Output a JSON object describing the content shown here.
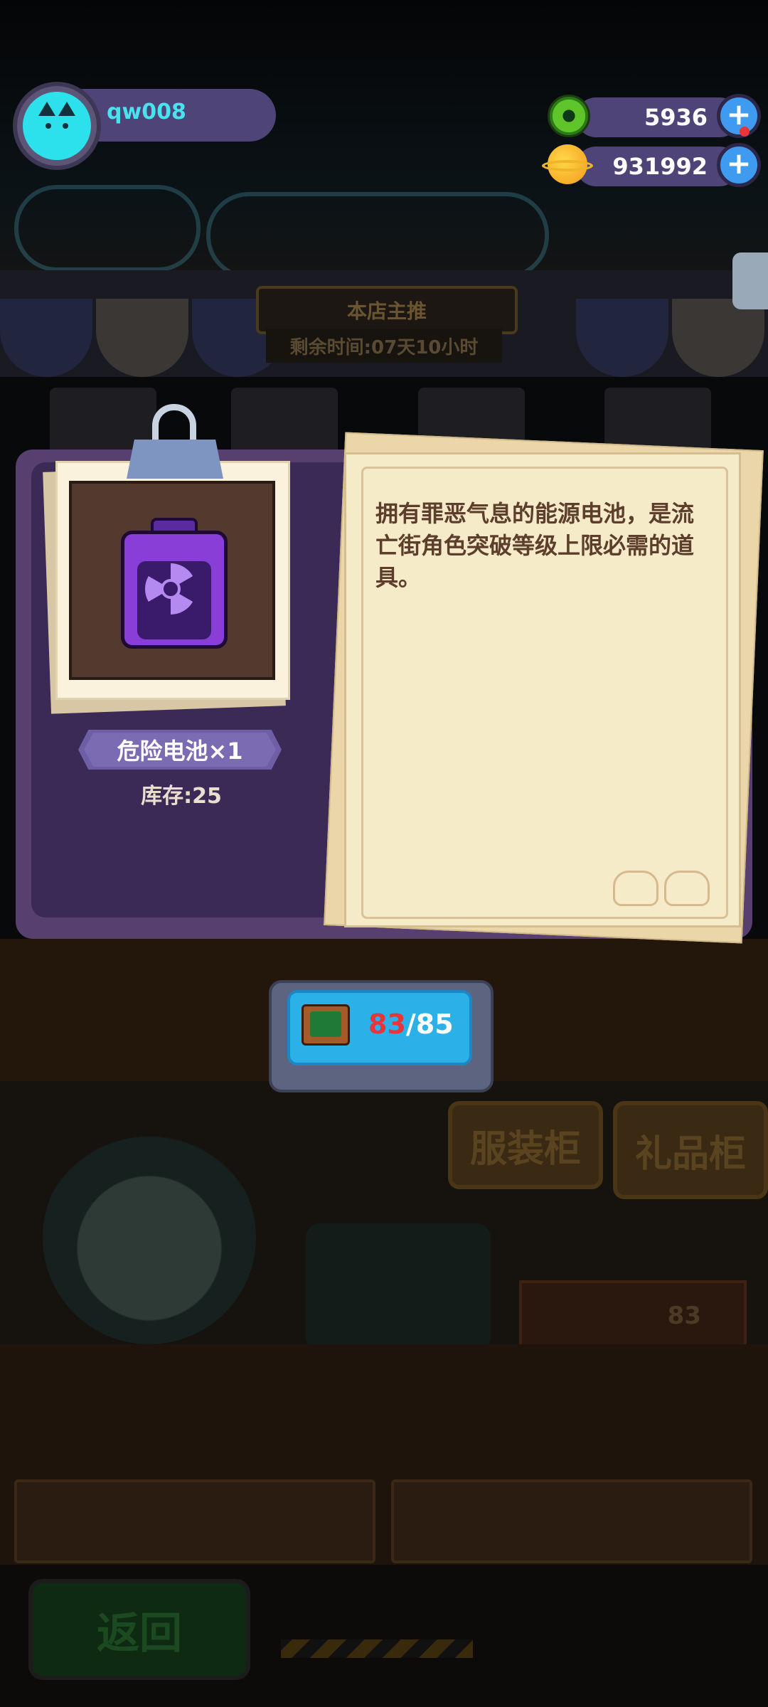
{
  "hud": {
    "username": "qw008",
    "currency_green": "5936",
    "currency_gold": "931992",
    "plus_symbol": "+"
  },
  "shop": {
    "banner_title": "本店主推",
    "timer": "剩余时间:07天10小时",
    "cabinet_clothing": "服装柜",
    "cabinet_gift": "礼品柜",
    "box_count": "83",
    "back_button": "返回"
  },
  "item": {
    "name_tag": "危险电池×1",
    "stock": "库存:25",
    "description": "拥有罪恶气息的能源电池，是流亡街角色突破等级上限必需的道具。"
  },
  "counter": {
    "current": "83",
    "separator": "/",
    "max": "85"
  },
  "colors": {
    "panel": "#57406f",
    "paper": "#f6ebc9",
    "accent_cyan": "#2ce0ec",
    "counter_red": "#e8343b"
  }
}
